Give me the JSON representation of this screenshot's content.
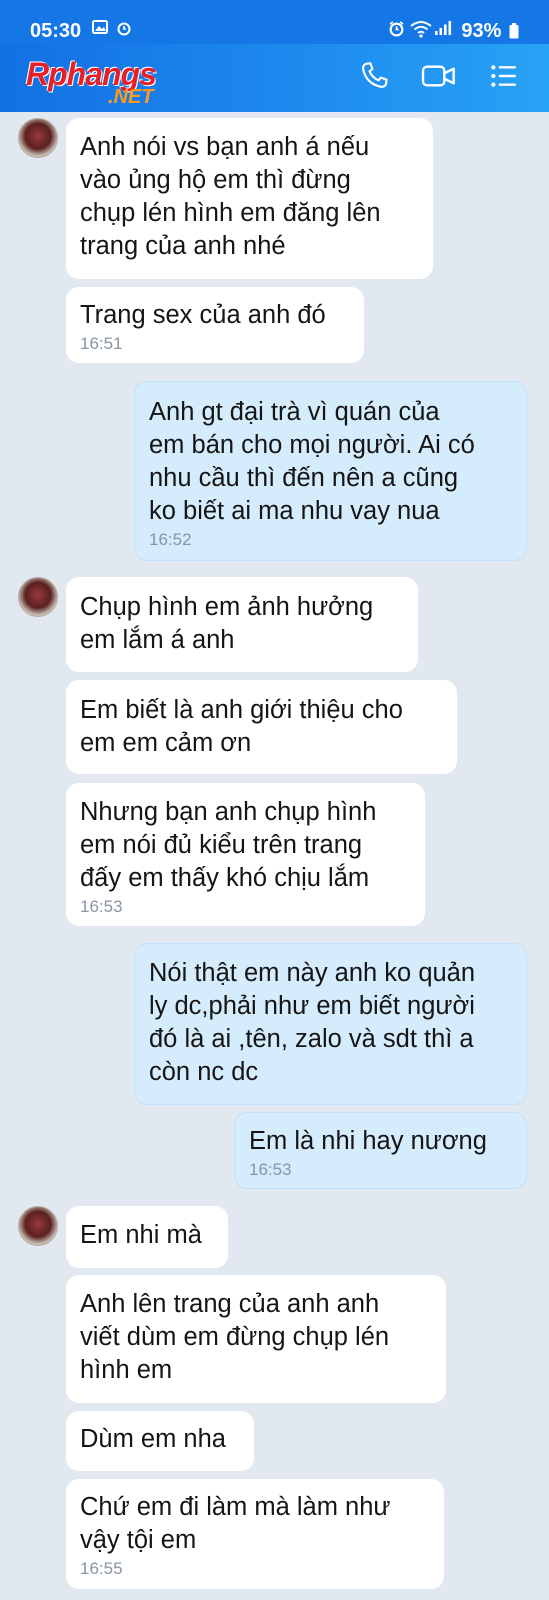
{
  "status_bar": {
    "time": "05:30",
    "battery": "93%"
  },
  "header": {
    "logo_text": "Rphangs",
    "logo_sub": ".NET"
  },
  "messages": [
    {
      "text": "Anh nói vs bạn anh á nếu\nvào ủng hộ em thì đừng\nchụp lén hình em đăng lên\ntrang của anh nhé"
    },
    {
      "text": "Trang sex của anh đó",
      "time": "16:51"
    },
    {
      "text": "Anh gt đại trà vì quán của\nem bán cho mọi người. Ai có\nnhu cầu thì đến nên a cũng\nko biết ai ma nhu vay nua",
      "time": "16:52"
    },
    {
      "text": "Chụp hình em ảnh hưởng\nem lắm á anh"
    },
    {
      "text": "Em biết là anh giới thiệu cho\nem em cảm ơn"
    },
    {
      "text": "Nhưng bạn anh chụp hình\nem nói đủ kiểu trên trang\nđấy em thấy khó chịu lắm",
      "time": "16:53"
    },
    {
      "text": "Nói thật em này anh ko quản\nly dc,phải như em biết người\nđó là ai ,tên, zalo và sdt thì a\ncòn nc dc"
    },
    {
      "text": "Em là nhi hay nương",
      "time": "16:53"
    },
    {
      "text": "Em nhi mà"
    },
    {
      "text": "Anh lên trang của anh anh\nviết dùm em đừng chụp lén\nhình em"
    },
    {
      "text": "Dùm em nha"
    },
    {
      "text": "Chứ em đi làm mà làm như\nvậy tội em",
      "time": "16:55"
    }
  ]
}
